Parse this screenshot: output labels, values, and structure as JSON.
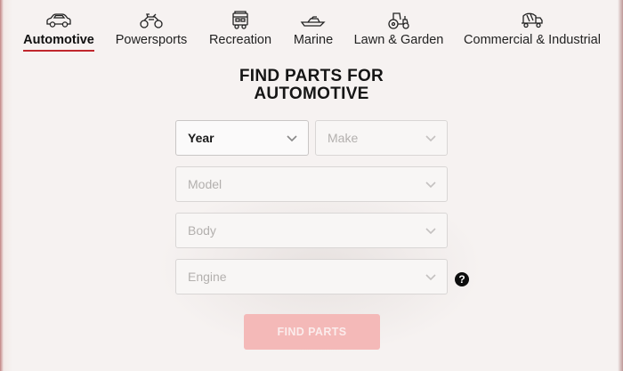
{
  "tabs": [
    {
      "label": "Automotive",
      "icon": "car-icon",
      "active": true
    },
    {
      "label": "Powersports",
      "icon": "atv-icon",
      "active": false
    },
    {
      "label": "Recreation",
      "icon": "rv-icon",
      "active": false
    },
    {
      "label": "Marine",
      "icon": "boat-icon",
      "active": false
    },
    {
      "label": "Lawn & Garden",
      "icon": "tractor-icon",
      "active": false
    },
    {
      "label": "Commercial & Industrial",
      "icon": "cement-truck-icon",
      "active": false
    }
  ],
  "finder": {
    "title_line1": "FIND PARTS FOR",
    "title_line2": "AUTOMOTIVE",
    "year": "Year",
    "make": "Make",
    "model": "Model",
    "body": "Body",
    "engine": "Engine",
    "help": "?",
    "submit": "FIND PARTS"
  },
  "colors": {
    "accent": "#c0272d",
    "button_disabled": "#f4b9b8"
  }
}
